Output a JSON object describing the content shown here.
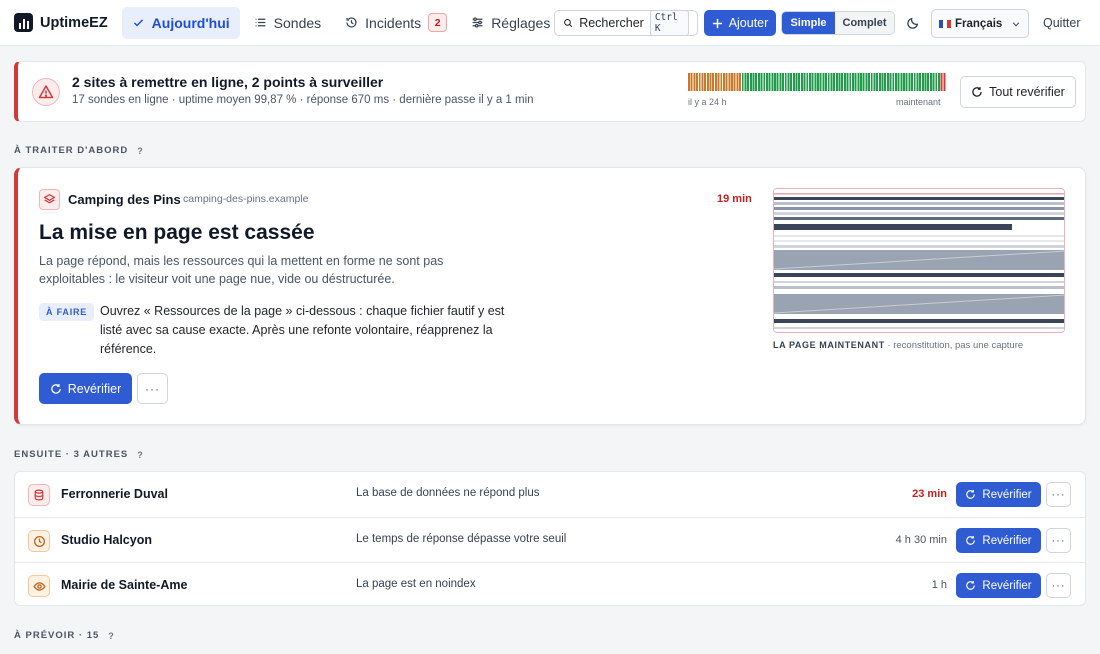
{
  "app": {
    "name": "UptimeEZ"
  },
  "nav": {
    "items": [
      {
        "label": "Aujourd'hui",
        "icon": "check-icon",
        "active": true
      },
      {
        "label": "Sondes",
        "icon": "list-icon"
      },
      {
        "label": "Incidents",
        "icon": "history-icon",
        "badge": "2"
      },
      {
        "label": "Réglages",
        "icon": "sliders-icon"
      }
    ]
  },
  "toolbar": {
    "search_label": "Rechercher",
    "search_shortcut": "Ctrl K",
    "add_label": "Ajouter",
    "mode_simple": "Simple",
    "mode_complet": "Complet",
    "language": "Français",
    "quit_label": "Quitter"
  },
  "summary": {
    "title": "2 sites à remettre en ligne, 2 points à surveiller",
    "subtitle": "17 sondes en ligne · uptime moyen 99,87 % · réponse 670 ms · dernière passe il y a 1 min",
    "bars_left_label": "il y a 24 h",
    "bars_right_label": "maintenant",
    "recheck_all_label": "Tout revérifier",
    "bar_states": [
      "warn",
      "warn",
      "warn",
      "warn",
      "warn",
      "warn",
      "warn",
      "warn",
      "warn",
      "warn",
      "warn",
      "warn",
      "warn",
      "warn",
      "warn",
      "warn",
      "warn",
      "warn",
      "warn",
      "warn",
      "ok",
      "ok",
      "ok",
      "ok",
      "ok",
      "ok",
      "ok",
      "ok",
      "ok",
      "ok",
      "ok",
      "ok",
      "ok",
      "ok",
      "ok",
      "ok",
      "ok",
      "ok",
      "ok",
      "ok",
      "ok",
      "ok",
      "ok",
      "ok",
      "ok",
      "ok",
      "ok",
      "ok",
      "ok",
      "ok",
      "ok",
      "ok",
      "ok",
      "ok",
      "ok",
      "ok",
      "ok",
      "ok",
      "ok",
      "ok",
      "ok",
      "ok",
      "ok",
      "ok",
      "ok",
      "ok",
      "ok",
      "ok",
      "ok",
      "ok",
      "ok",
      "ok",
      "ok",
      "ok",
      "ok",
      "ok",
      "ok",
      "ok",
      "ok",
      "ok",
      "ok",
      "ok",
      "ok",
      "ok",
      "ok",
      "ok",
      "ok",
      "ok",
      "ok",
      "ok",
      "ok",
      "ok",
      "ok",
      "ok",
      "down",
      "down"
    ],
    "colors": {
      "ok": "#1f9d4a",
      "warn": "#c9792a",
      "down": "#d23a3a"
    }
  },
  "section_first": {
    "label": "À TRAITER D'ABORD",
    "help": "?"
  },
  "featured": {
    "site_name": "Camping des Pins",
    "site_domain": "camping-des-pins.example",
    "age": "19 min",
    "title": "La mise en page est cassée",
    "description": "La page répond, mais les ressources qui la mettent en forme ne sont pas exploitables : le visiteur voit une page nue, vide ou déstructurée.",
    "todo_label": "À FAIRE",
    "todo_text": "Ouvrez « Ressources de la page » ci-dessous : chaque fichier fautif y est listé avec sa cause exacte. Après une refonte volontaire, réapprenez la référence.",
    "recheck_label": "Revérifier",
    "more_label": "···",
    "preview_caption_strong": "LA PAGE MAINTENANT",
    "preview_caption_rest": " · reconstitution, pas une capture"
  },
  "section_next": {
    "label": "ENSUITE · 3 AUTRES",
    "help": "?"
  },
  "others": [
    {
      "name": "Ferronnerie Duval",
      "issue": "La base de données ne répond plus",
      "age": "23 min",
      "urgent": true,
      "icon": "database-icon",
      "icon_color": "#d23a3a",
      "icon_bg": "#fdecec"
    },
    {
      "name": "Studio Halcyon",
      "issue": "Le temps de réponse dépasse votre seuil",
      "age": "4 h 30 min",
      "urgent": false,
      "icon": "clock-icon",
      "icon_color": "#c2611b",
      "icon_bg": "#fdf1e4"
    },
    {
      "name": "Mairie de Sainte-Ame",
      "issue": "La page est en noindex",
      "age": "1 h",
      "urgent": false,
      "icon": "eye-icon",
      "icon_color": "#c2611b",
      "icon_bg": "#fdf1e4"
    }
  ],
  "row_recheck_label": "Revérifier",
  "section_later": {
    "label": "À PRÉVOIR · 15",
    "help": "?"
  }
}
